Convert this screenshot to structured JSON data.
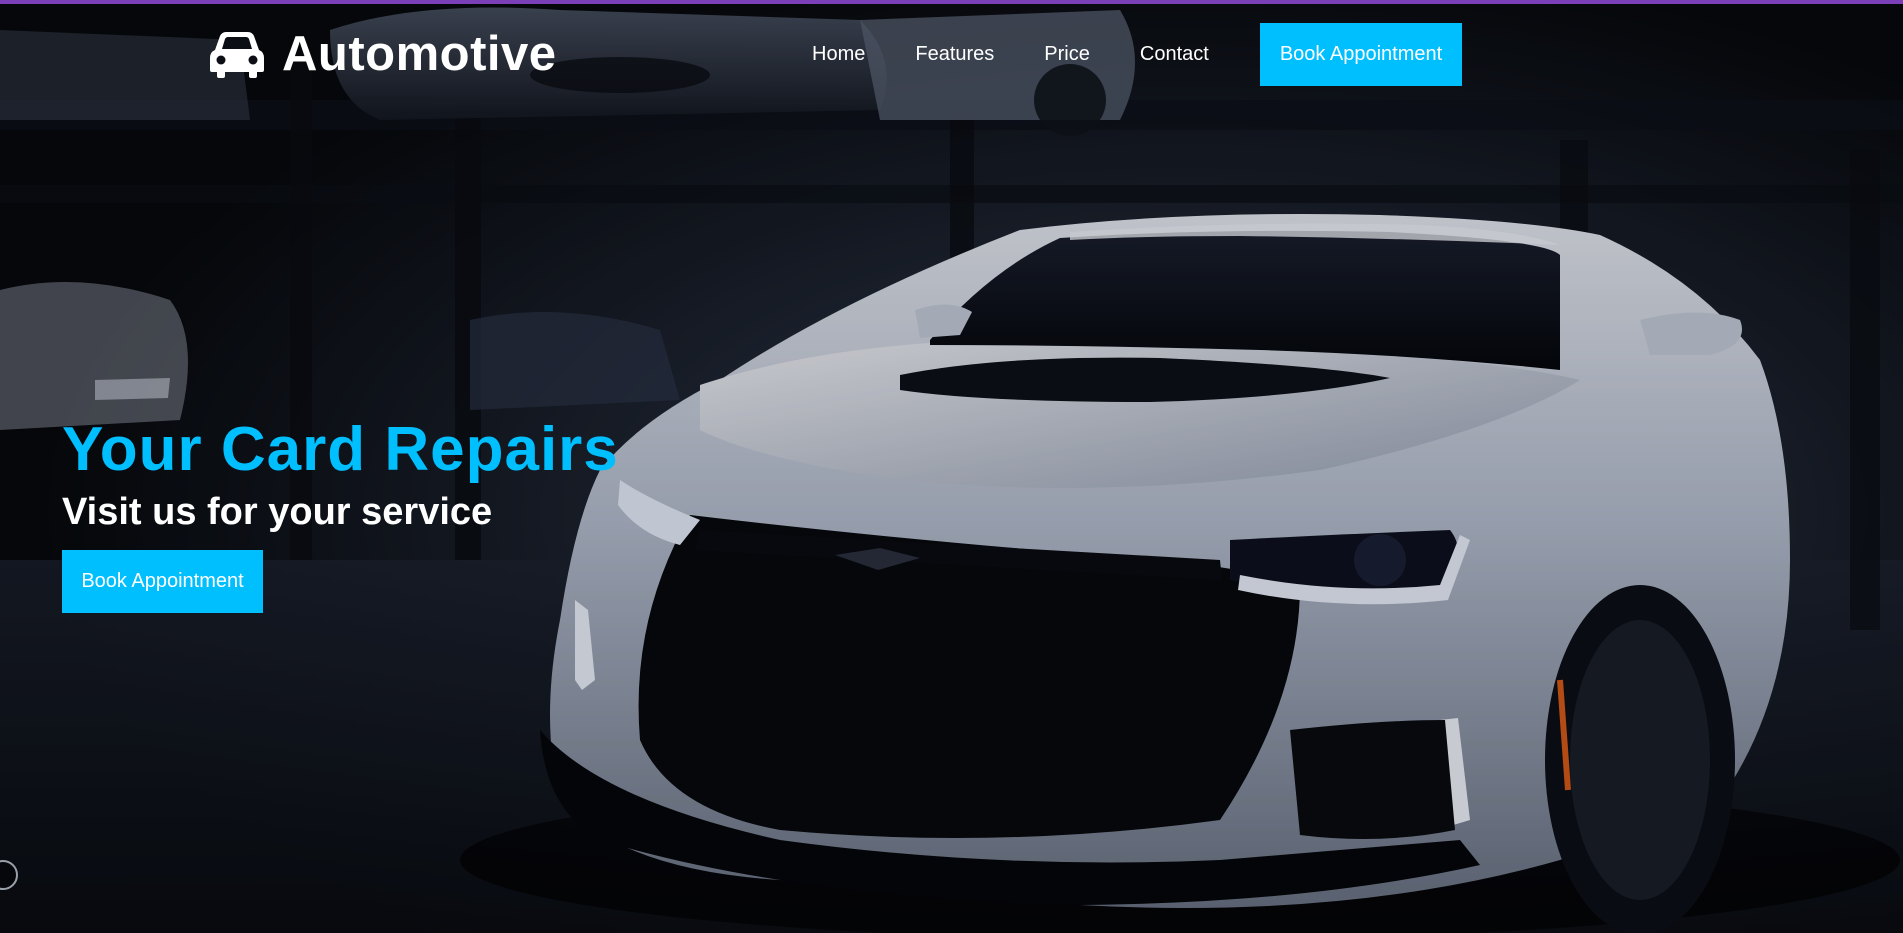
{
  "nav": {
    "brand": "Automotive",
    "brand_icon": "car-icon",
    "links": [
      {
        "label": "Home"
      },
      {
        "label": "Features"
      },
      {
        "label": "Price"
      },
      {
        "label": "Contact"
      }
    ],
    "cta_label": "Book Appointment"
  },
  "hero": {
    "title": "Your Card Repairs",
    "subtitle": "Visit us for your service",
    "cta_label": "Book Appointment",
    "background": "white sports car in dark garage"
  },
  "colors": {
    "accent": "#00bfff",
    "top_strip": "#7b3fb8",
    "text": "#ffffff",
    "background": "#0b0e14"
  }
}
